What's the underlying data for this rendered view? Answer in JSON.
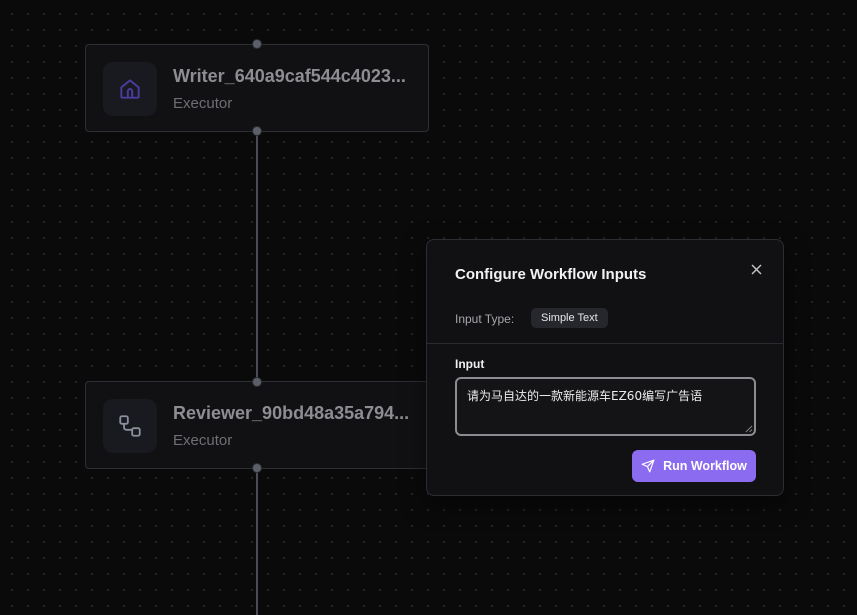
{
  "nodes": [
    {
      "title": "Writer_640a9caf544c4023...",
      "subtitle": "Executor",
      "icon": "home-icon",
      "icon_color": "#4b3aa0"
    },
    {
      "title": "Reviewer_90bd48a35a794...",
      "subtitle": "Executor",
      "icon": "workflow-icon",
      "icon_color": "#8a8f9a"
    }
  ],
  "dialog": {
    "title": "Configure Workflow Inputs",
    "close_icon": "close-icon",
    "input_type_label": "Input Type:",
    "input_type_value": "Simple Text",
    "input_label": "Input",
    "input_value": "请为马自达的一款新能源车EZ60编写广告语",
    "run_button_label": "Run Workflow",
    "run_button_icon": "send-icon",
    "accent_color": "#8b6cf0"
  },
  "colors": {
    "background": "#0a0a0b",
    "node_background": "#111113",
    "edge": "#4a4d57"
  }
}
